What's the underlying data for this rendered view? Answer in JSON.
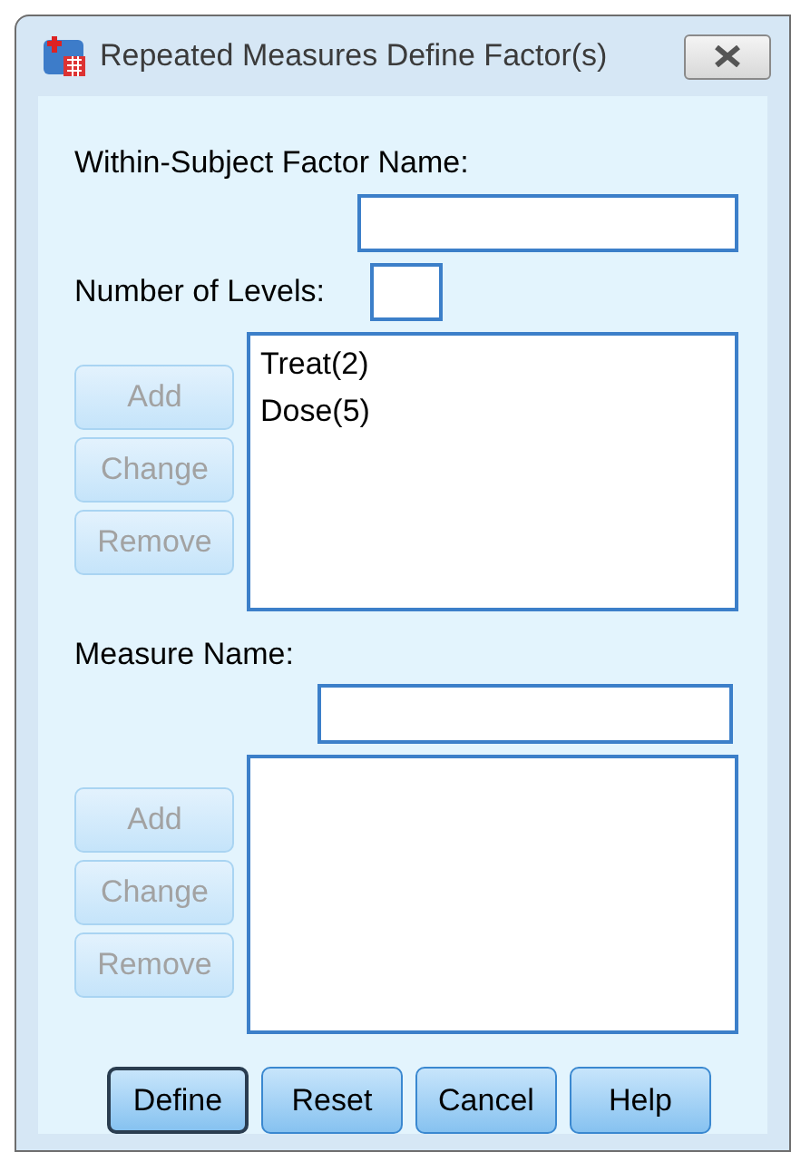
{
  "window": {
    "title": "Repeated Measures Define Factor(s)"
  },
  "factor_name": {
    "label": "Within-Subject Factor Name:"
  },
  "levels": {
    "label": "Number of Levels:"
  },
  "factor_buttons": [
    {
      "label": "Add",
      "disabled": true
    },
    {
      "label": "Change",
      "disabled": true
    },
    {
      "label": "Remove",
      "disabled": true
    }
  ],
  "factor_list": [
    "Treat(2)",
    "Dose(5)"
  ],
  "measure_name": {
    "label": "Measure Name:"
  },
  "measure_buttons": [
    {
      "label": "Add",
      "disabled": true
    },
    {
      "label": "Change",
      "disabled": true
    },
    {
      "label": "Remove",
      "disabled": true
    }
  ],
  "buttons": [
    {
      "label": "Define",
      "default": true
    },
    {
      "label": "Reset",
      "default": false
    },
    {
      "label": "Cancel",
      "default": false
    },
    {
      "label": "Help",
      "default": false
    }
  ]
}
